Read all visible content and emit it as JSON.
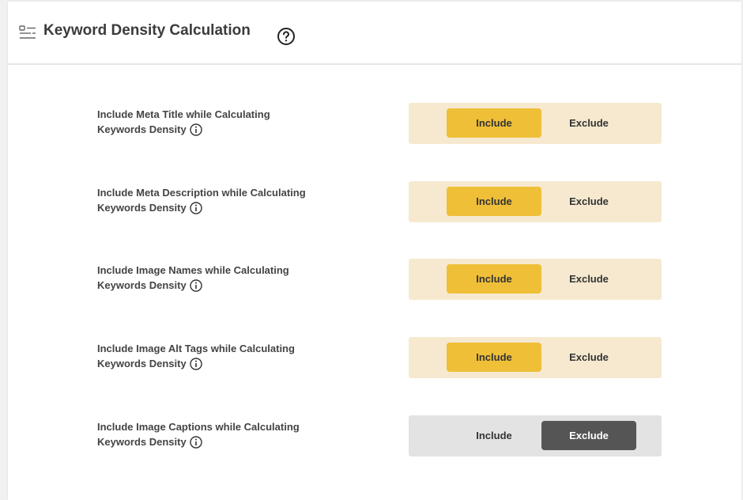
{
  "header": {
    "title": "Keyword Density Calculation",
    "help_icon": "question-circle-icon",
    "list_icon": "list-settings-icon"
  },
  "colors": {
    "include_active": "#efbf38",
    "include_track": "#f6e9cf",
    "exclude_active": "#555555",
    "exclude_track": "#e3e3e3"
  },
  "settings": [
    {
      "line1": "Include Meta Title while Calculating",
      "line2": "Keywords Density",
      "include_label": "Include",
      "exclude_label": "Exclude",
      "selected": "Include"
    },
    {
      "line1": "Include Meta Description while Calculating",
      "line2": "Keywords Density",
      "include_label": "Include",
      "exclude_label": "Exclude",
      "selected": "Include"
    },
    {
      "line1": "Include Image Names while Calculating",
      "line2": "Keywords Density",
      "include_label": "Include",
      "exclude_label": "Exclude",
      "selected": "Include"
    },
    {
      "line1": "Include Image Alt Tags while Calculating",
      "line2": "Keywords Density",
      "include_label": "Include",
      "exclude_label": "Exclude",
      "selected": "Include"
    },
    {
      "line1": "Include Image Captions while Calculating",
      "line2": "Keywords Density",
      "include_label": "Include",
      "exclude_label": "Exclude",
      "selected": "Exclude"
    }
  ]
}
